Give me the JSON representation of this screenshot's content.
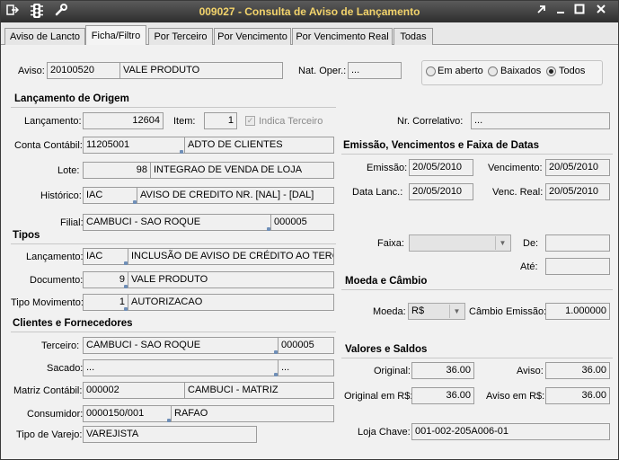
{
  "window": {
    "title": "009027 - Consulta de Aviso de Lançamento"
  },
  "tabs": [
    "Aviso de Lancto",
    "Ficha/Filtro",
    "Por Terceiro",
    "Por Vencimento",
    "Por Vencimento Real",
    "Todas"
  ],
  "header": {
    "aviso_label": "Aviso:",
    "aviso_number": "20100520",
    "aviso_desc": "VALE PRODUTO",
    "nat_oper_label": "Nat. Oper.:",
    "nat_oper_value": "...",
    "status_options": [
      "Em aberto",
      "Baixados",
      "Todos"
    ],
    "status_selected": "Todos"
  },
  "origem": {
    "section_title": "Lançamento de Origem",
    "lancamento_label": "Lançamento:",
    "lancamento_value": "12604",
    "item_label": "Item:",
    "item_value": "1",
    "indica_terceiro_label": "Indica Terceiro",
    "indica_terceiro_checked": true,
    "conta_label": "Conta Contábil:",
    "conta_code": "11205001",
    "conta_desc": "ADTO DE CLIENTES",
    "lote_label": "Lote:",
    "lote_code": "98",
    "lote_desc": "INTEGRAO DE VENDA DE LOJA",
    "historico_label": "Histórico:",
    "historico_code": "IAC",
    "historico_desc": "AVISO DE CREDITO NR. [NAL] - [DAL]",
    "filial_label": "Filial:",
    "filial_name": "CAMBUCI - SAO ROQUE",
    "filial_code": "000005",
    "nr_correlativo_label": "Nr. Correlativo:",
    "nr_correlativo_value": "..."
  },
  "tipos": {
    "section_title": "Tipos",
    "lancamento_label": "Lançamento:",
    "lancamento_code": "IAC",
    "lancamento_desc": "INCLUSÃO DE AVISO DE CRÉDITO AO TERCEIR",
    "documento_label": "Documento:",
    "documento_code": "9",
    "documento_desc": "VALE PRODUTO",
    "tipo_mov_label": "Tipo Movimento:",
    "tipo_mov_code": "1",
    "tipo_mov_desc": "AUTORIZACAO"
  },
  "datas": {
    "section_title": "Emissão, Vencimentos e Faixa de Datas",
    "emissao_label": "Emissão:",
    "emissao_value": "20/05/2010",
    "vencimento_label": "Vencimento:",
    "vencimento_value": "20/05/2010",
    "data_lanc_label": "Data Lanc.:",
    "data_lanc_value": "20/05/2010",
    "venc_real_label": "Venc. Real:",
    "venc_real_value": "20/05/2010",
    "faixa_label": "Faixa:",
    "faixa_value": "",
    "de_label": "De:",
    "de_value": "",
    "ate_label": "Até:",
    "ate_value": ""
  },
  "moeda": {
    "section_title": "Moeda e Câmbio",
    "moeda_label": "Moeda:",
    "moeda_value": "R$",
    "cambio_label": "Câmbio Emissão:",
    "cambio_value": "1.000000"
  },
  "clientes": {
    "section_title": "Clientes e Fornecedores",
    "terceiro_label": "Terceiro:",
    "terceiro_name": "CAMBUCI - SAO ROQUE",
    "terceiro_code": "000005",
    "sacado_label": "Sacado:",
    "sacado_name": "...",
    "sacado_code": "...",
    "matriz_label": "Matriz Contábil:",
    "matriz_code": "000002",
    "matriz_name": "CAMBUCI - MATRIZ",
    "consumidor_label": "Consumidor:",
    "consumidor_code": "0000150/001",
    "consumidor_name": "RAFAO",
    "tipo_varejo_label": "Tipo de Varejo:",
    "tipo_varejo_value": "VAREJISTA"
  },
  "valores": {
    "section_title": "Valores e Saldos",
    "original_label": "Original:",
    "original_value": "36.00",
    "aviso_label": "Aviso:",
    "aviso_value": "36.00",
    "original_rs_label": "Original em R$:",
    "original_rs_value": "36.00",
    "aviso_rs_label": "Aviso em R$:",
    "aviso_rs_value": "36.00",
    "loja_chave_label": "Loja Chave:",
    "loja_chave_value": "001-002-205A006-01"
  },
  "colors": {
    "title_text": "#f2d36b",
    "titlebar_bg": "#3a3a3a"
  },
  "icons": [
    "exit-icon",
    "traffic-light-icon",
    "wrench-icon",
    "restore-icon",
    "minimize-icon",
    "maximize-icon",
    "close-icon"
  ]
}
